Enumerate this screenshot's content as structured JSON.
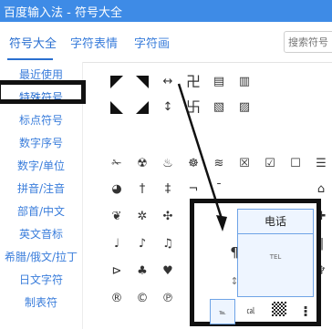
{
  "window": {
    "title": "百度输入法 - 符号大全"
  },
  "tabs": [
    {
      "label": "符号大全"
    },
    {
      "label": "字符表情"
    },
    {
      "label": "字符画"
    }
  ],
  "search": {
    "placeholder": "搜索符号"
  },
  "sidebar": {
    "items": [
      {
        "label": "最近使用"
      },
      {
        "label": "特殊符号"
      },
      {
        "label": "标点符号"
      },
      {
        "label": "数字序号"
      },
      {
        "label": "数字/单位"
      },
      {
        "label": "拼音/注音"
      },
      {
        "label": "部首/中文"
      },
      {
        "label": "英文音标"
      },
      {
        "label": "希腊/俄文/拉丁"
      },
      {
        "label": "日文字符"
      },
      {
        "label": "制表符"
      }
    ]
  },
  "symbols": {
    "row1": [
      "↔",
      "卍",
      "▤",
      "▥"
    ],
    "row2": [
      "↕",
      "卐",
      "▧",
      "▨"
    ],
    "row3": [
      "✁",
      "☢",
      "♨",
      "☸",
      "≋",
      "☒",
      "☑",
      "☐",
      "☰",
      "☷",
      "⊕"
    ],
    "row4": [
      "◕",
      "†",
      "‡",
      "¬",
      "¯"
    ],
    "row5": [
      "❦",
      "✲",
      "✣"
    ],
    "row6": [
      "♩",
      "♪",
      "♫"
    ],
    "row7": [
      "⊳",
      "♣",
      "♥"
    ],
    "row8": [
      "®",
      "©",
      "℗"
    ],
    "right_col": [
      "⌂",
      "✚",
      "‖",
      "♆"
    ],
    "pilcrow": "¶"
  },
  "popup": {
    "title": "电话",
    "preview": "TEL",
    "cells": [
      "℡",
      "㎈",
      "⁝"
    ]
  }
}
